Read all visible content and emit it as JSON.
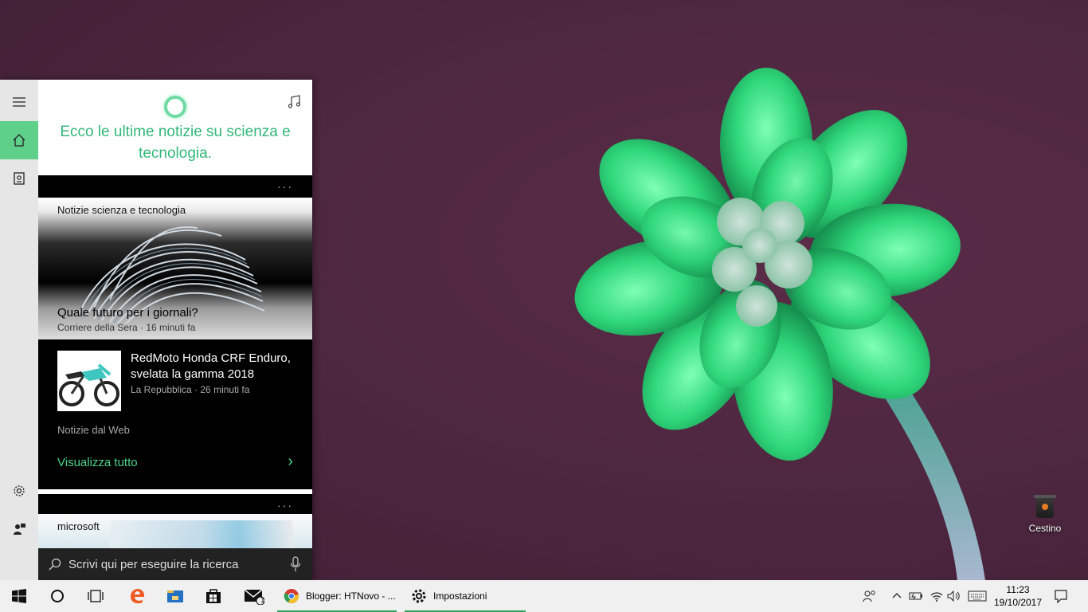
{
  "cortana": {
    "greeting": "Ecco le ultime notizie su scienza e tecnologia.",
    "rail_items": [
      "menu-icon",
      "home-icon",
      "notebook-icon",
      "settings-icon",
      "feedback-icon"
    ],
    "news_card": {
      "category": "Notizie scienza e tecnologia",
      "title": "Quale futuro per i giornali?",
      "source": "Corriere della Sera · 16 minuti fa"
    },
    "story_card": {
      "title": "RedMoto Honda CRF Enduro, svelata la gamma 2018",
      "source": "La Repubblica · 26 minuti fa",
      "footer": "Notizie dal Web",
      "see_all": "Visualizza tutto"
    },
    "second_card": {
      "label": "microsoft"
    },
    "more_dots": "···",
    "search": {
      "placeholder": "Scrivi qui per eseguire la ricerca"
    }
  },
  "desktop": {
    "recycle_bin_label": "Cestino"
  },
  "taskbar": {
    "apps": [
      {
        "label": "Blogger: HTNovo - ...",
        "icon": "chrome-icon",
        "active": true
      },
      {
        "label": "Impostazioni",
        "icon": "settings-gear-icon",
        "active": true
      }
    ],
    "clock": {
      "time": "11:23",
      "date": "19/10/2017"
    },
    "mail_badge": "1"
  },
  "colors": {
    "accent_green": "#31b878",
    "rail_active": "#5fd08a",
    "wallpaper": "#4e2740"
  }
}
